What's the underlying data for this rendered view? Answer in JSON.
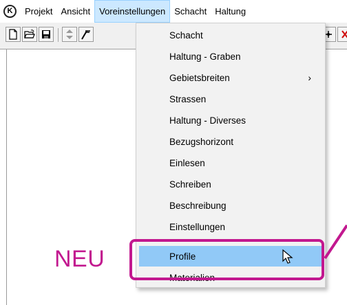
{
  "menubar": {
    "items": [
      "Projekt",
      "Ansicht",
      "Voreinstellungen",
      "Schacht",
      "Haltung"
    ]
  },
  "app_icon": {
    "glyph": "K"
  },
  "dropdown": {
    "items": [
      "Schacht",
      "Haltung - Graben",
      "Gebietsbreiten",
      "Strassen",
      "Haltung - Diverses",
      "Bezugshorizont",
      "Einlesen",
      "Schreiben",
      "Beschreibung",
      "Einstellungen",
      "Profile",
      "Materialien"
    ],
    "submenu_arrow": "›",
    "highlighted": "Profile"
  },
  "annotation": {
    "label": "NEU",
    "color": "#c2188f"
  },
  "colors": {
    "menu_active_bg": "#cce8ff",
    "item_highlight_bg": "#91c9f7",
    "toolbar_bg": "#f0f0f0"
  },
  "icons": [
    "new-file-icon",
    "open-folder-icon",
    "save-icon",
    "up-down-arrows-icon",
    "pen-tool-icon",
    "grid-tool-icon",
    "close-red-icon",
    "mouse-pointer-icon"
  ]
}
